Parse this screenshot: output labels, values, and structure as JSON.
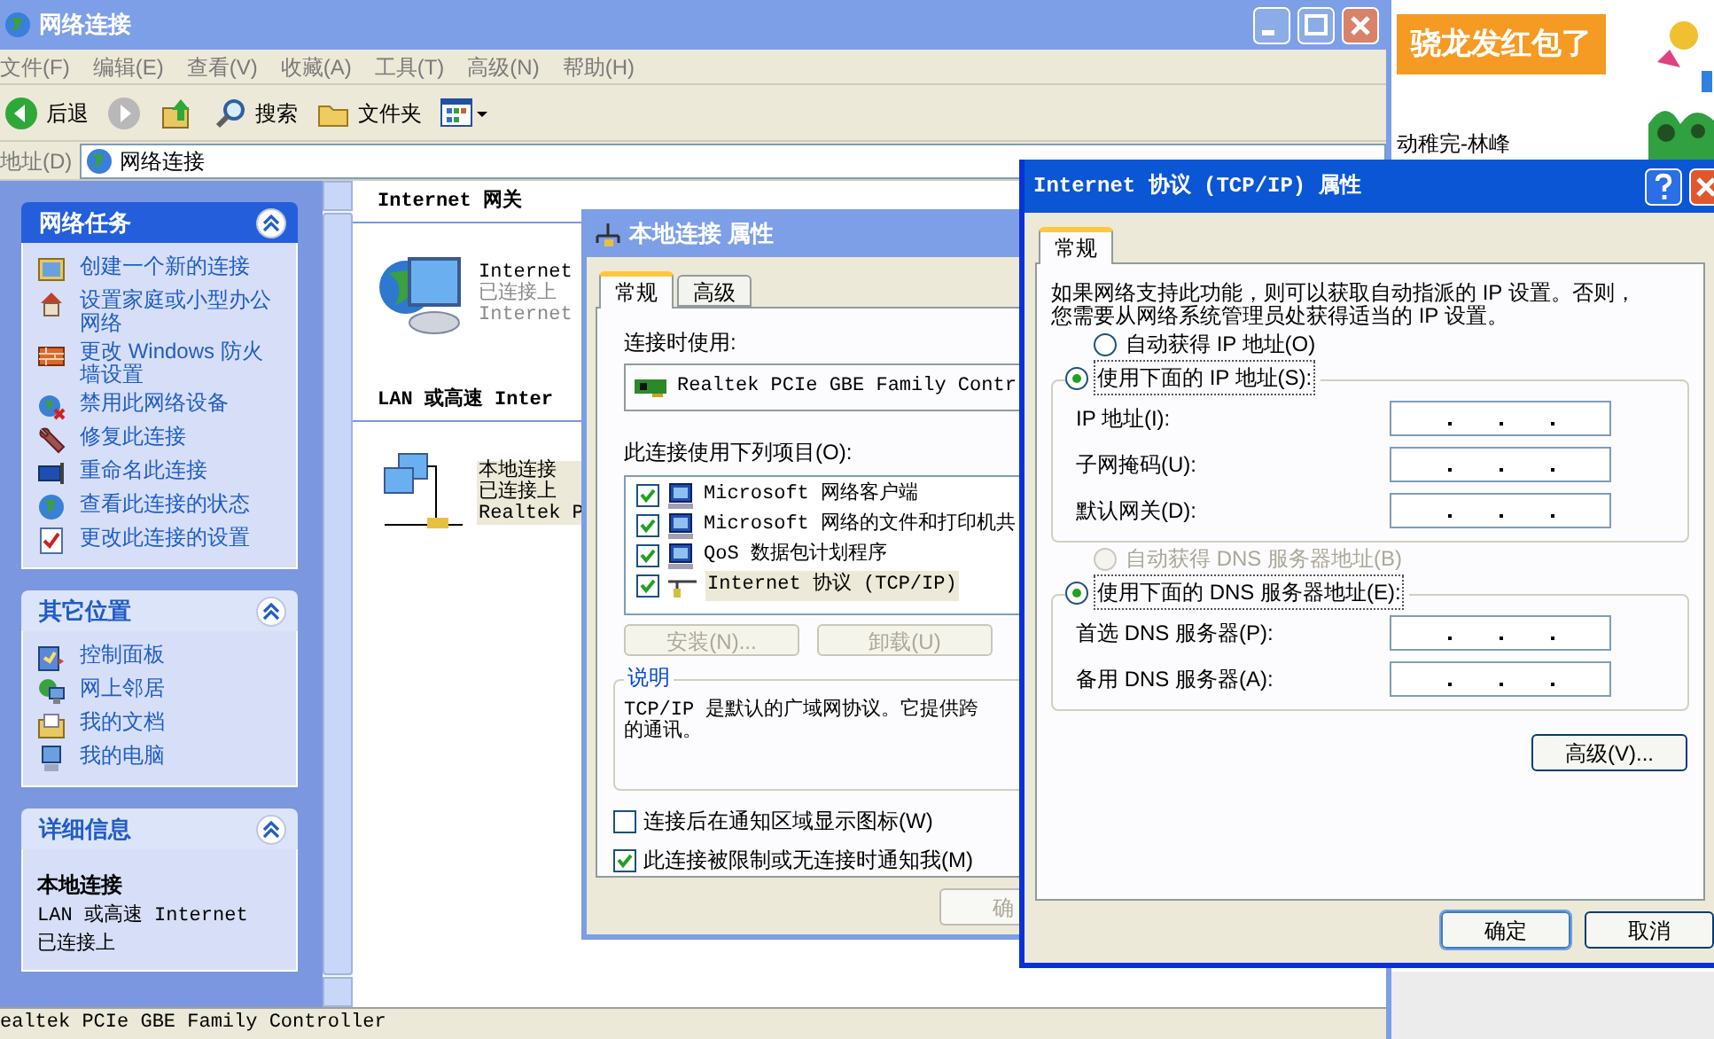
{
  "main_window": {
    "title": "网络连接",
    "menu": [
      "文件(F)",
      "编辑(E)",
      "查看(V)",
      "收藏(A)",
      "工具(T)",
      "高级(N)",
      "帮助(H)"
    ],
    "toolbar": [
      {
        "kind": "back",
        "label": "后退"
      },
      {
        "kind": "forward"
      },
      {
        "kind": "up"
      },
      {
        "kind": "search",
        "label": "搜索"
      },
      {
        "kind": "folders",
        "label": "文件夹"
      },
      {
        "kind": "views"
      }
    ],
    "address": {
      "label": "地址(D)",
      "value": "网络连接"
    },
    "task_panels": [
      {
        "title": "网络任务",
        "kind": "special",
        "expanded": true,
        "items": [
          {
            "kind": "wizard",
            "label": "创建一个新的连接"
          },
          {
            "kind": "home",
            "label": "设置家庭或小型办公网络"
          },
          {
            "kind": "firewall",
            "label": "更改 Windows 防火墙设置"
          },
          {
            "kind": "disable",
            "label": "禁用此网络设备"
          },
          {
            "kind": "wrench",
            "label": "修复此连接"
          },
          {
            "kind": "rename",
            "label": "重命名此连接"
          },
          {
            "kind": "status",
            "label": "查看此连接的状态"
          },
          {
            "kind": "settings",
            "label": "更改此连接的设置"
          }
        ]
      },
      {
        "title": "其它位置",
        "kind": "normal",
        "expanded": true,
        "items": [
          {
            "kind": "control",
            "label": "控制面板"
          },
          {
            "kind": "network",
            "label": "网上邻居"
          },
          {
            "kind": "documents",
            "label": "我的文档"
          },
          {
            "kind": "computer",
            "label": "我的电脑"
          }
        ]
      },
      {
        "title": "详细信息",
        "kind": "normal",
        "expanded": true,
        "details": {
          "title": "本地连接",
          "lines": [
            "LAN 或高速 Internet",
            "已连接上"
          ]
        }
      }
    ],
    "groups": [
      {
        "header": "Internet 网关",
        "items": [
          {
            "kind": "gateway",
            "selected": false,
            "disabled": true,
            "lines": [
              "Internet",
              "已连接上",
              "Internet"
            ]
          }
        ]
      },
      {
        "header": "LAN 或高速 Inter",
        "items": [
          {
            "kind": "lan",
            "selected": true,
            "disabled": false,
            "lines": [
              "本地连接",
              "已连接上",
              "Realtek P"
            ]
          }
        ]
      }
    ],
    "status_bar": "ealtek PCIe GBE Family Controller"
  },
  "connection_dialog": {
    "title": "本地连接 属性",
    "tabs": [
      {
        "label": "常规",
        "selected": true
      },
      {
        "label": "高级",
        "selected": false
      }
    ],
    "connect_using_label": "连接时使用:",
    "adapter": "Realtek PCIe GBE Family Contr",
    "items_label": "此连接使用下列项目(O):",
    "components": [
      {
        "kind": "client",
        "label": "Microsoft 网络客户端",
        "checked": true,
        "selected": false
      },
      {
        "kind": "service",
        "label": "Microsoft 网络的文件和打印机共",
        "checked": true,
        "selected": false
      },
      {
        "kind": "service",
        "label": "QoS 数据包计划程序",
        "checked": true,
        "selected": false
      },
      {
        "kind": "protocol",
        "label": "Internet 协议 (TCP/IP)",
        "checked": true,
        "selected": true
      }
    ],
    "buttons": [
      {
        "label": "安装(N)...",
        "disabled": true
      },
      {
        "label": "卸载(U)",
        "disabled": true
      }
    ],
    "description": {
      "title": "说明",
      "lines": [
        "TCP/IP 是默认的广域网协议。它提供跨",
        "的通讯。"
      ]
    },
    "options": [
      {
        "label": "连接后在通知区域显示图标(W)",
        "checked": false
      },
      {
        "label": "此连接被限制或无连接时通知我(M)",
        "checked": true
      }
    ],
    "ok_button": "确"
  },
  "tcpip_dialog": {
    "title": "Internet 协议 (TCP/IP) 属性",
    "tabs": [
      {
        "label": "常规",
        "selected": true
      }
    ],
    "intro": [
      "如果网络支持此功能，则可以获取自动指派的 IP 设置。否则，",
      "您需要从网络系统管理员处获得适当的 IP 设置。"
    ],
    "ip_options": [
      {
        "label": "自动获得 IP 地址(O)",
        "selected": false,
        "disabled": false
      },
      {
        "label": "使用下面的 IP 地址(S):",
        "selected": true,
        "disabled": false
      }
    ],
    "ip_fields": [
      {
        "label": "IP 地址(I):"
      },
      {
        "label": "子网掩码(U):"
      },
      {
        "label": "默认网关(D):"
      }
    ],
    "dns_options": [
      {
        "label": "自动获得 DNS 服务器地址(B)",
        "selected": false,
        "disabled": true
      },
      {
        "label": "使用下面的 DNS 服务器地址(E):",
        "selected": true,
        "disabled": false
      }
    ],
    "dns_fields": [
      {
        "label": "首选 DNS 服务器(P):"
      },
      {
        "label": "备用 DNS 服务器(A):"
      }
    ],
    "advanced_button": "高级(V)...",
    "buttons": [
      "确定",
      "取消"
    ]
  },
  "desktop": {
    "banner": "骁龙发红包了",
    "text": "动稚完-林峰"
  }
}
